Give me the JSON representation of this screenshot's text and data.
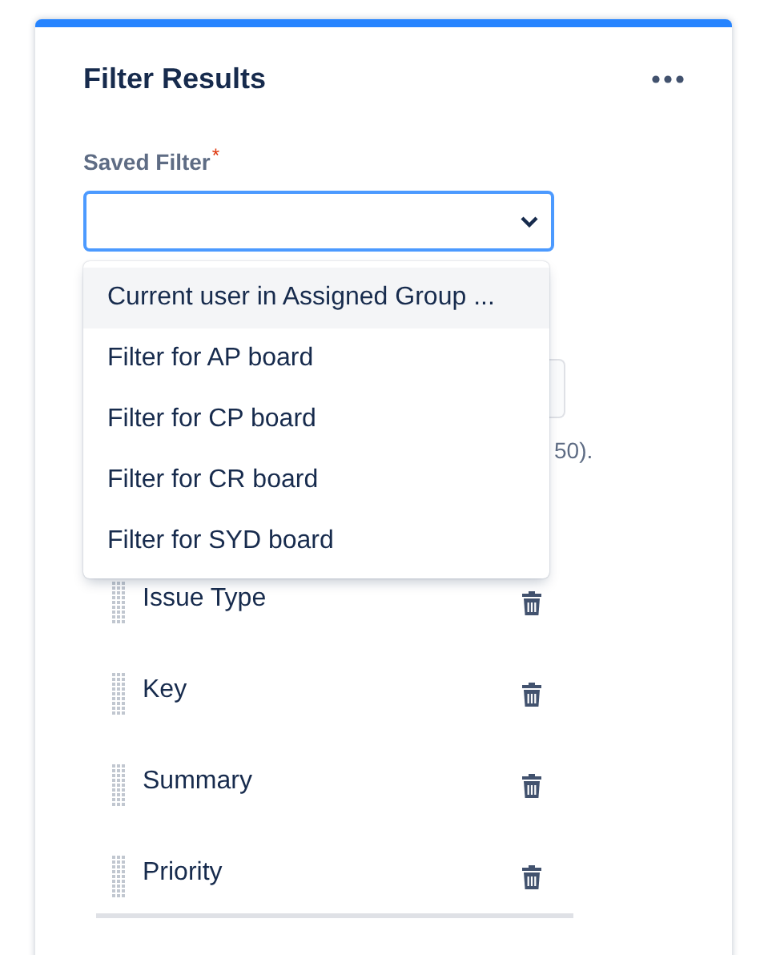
{
  "panel": {
    "title": "Filter Results"
  },
  "saved_filter": {
    "label": "Saved Filter",
    "required_mark": "*",
    "open": true,
    "options": [
      {
        "label": "Current user in Assigned Group ...",
        "selected": true
      },
      {
        "label": "Filter for AP board",
        "selected": false
      },
      {
        "label": "Filter for CP board",
        "selected": false
      },
      {
        "label": "Filter for CR board",
        "selected": false
      },
      {
        "label": "Filter for SYD board",
        "selected": false
      }
    ]
  },
  "hint_fragment": "50).",
  "columns": [
    {
      "label": "Issue Type"
    },
    {
      "label": "Key"
    },
    {
      "label": "Summary"
    },
    {
      "label": "Priority"
    }
  ]
}
